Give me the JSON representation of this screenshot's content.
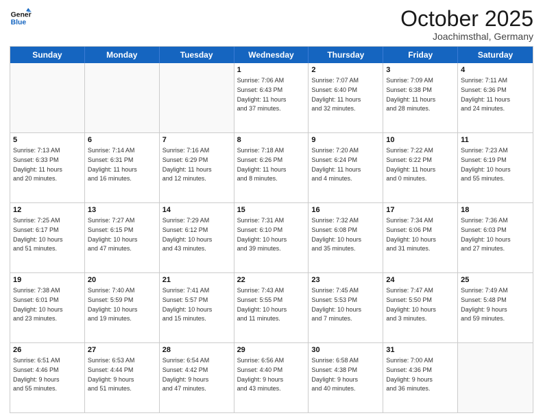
{
  "logo": {
    "line1": "General",
    "line2": "Blue"
  },
  "title": "October 2025",
  "location": "Joachimsthal, Germany",
  "weekdays": [
    "Sunday",
    "Monday",
    "Tuesday",
    "Wednesday",
    "Thursday",
    "Friday",
    "Saturday"
  ],
  "weeks": [
    [
      {
        "day": "",
        "text": ""
      },
      {
        "day": "",
        "text": ""
      },
      {
        "day": "",
        "text": ""
      },
      {
        "day": "1",
        "text": "Sunrise: 7:06 AM\nSunset: 6:43 PM\nDaylight: 11 hours\nand 37 minutes."
      },
      {
        "day": "2",
        "text": "Sunrise: 7:07 AM\nSunset: 6:40 PM\nDaylight: 11 hours\nand 32 minutes."
      },
      {
        "day": "3",
        "text": "Sunrise: 7:09 AM\nSunset: 6:38 PM\nDaylight: 11 hours\nand 28 minutes."
      },
      {
        "day": "4",
        "text": "Sunrise: 7:11 AM\nSunset: 6:36 PM\nDaylight: 11 hours\nand 24 minutes."
      }
    ],
    [
      {
        "day": "5",
        "text": "Sunrise: 7:13 AM\nSunset: 6:33 PM\nDaylight: 11 hours\nand 20 minutes."
      },
      {
        "day": "6",
        "text": "Sunrise: 7:14 AM\nSunset: 6:31 PM\nDaylight: 11 hours\nand 16 minutes."
      },
      {
        "day": "7",
        "text": "Sunrise: 7:16 AM\nSunset: 6:29 PM\nDaylight: 11 hours\nand 12 minutes."
      },
      {
        "day": "8",
        "text": "Sunrise: 7:18 AM\nSunset: 6:26 PM\nDaylight: 11 hours\nand 8 minutes."
      },
      {
        "day": "9",
        "text": "Sunrise: 7:20 AM\nSunset: 6:24 PM\nDaylight: 11 hours\nand 4 minutes."
      },
      {
        "day": "10",
        "text": "Sunrise: 7:22 AM\nSunset: 6:22 PM\nDaylight: 11 hours\nand 0 minutes."
      },
      {
        "day": "11",
        "text": "Sunrise: 7:23 AM\nSunset: 6:19 PM\nDaylight: 10 hours\nand 55 minutes."
      }
    ],
    [
      {
        "day": "12",
        "text": "Sunrise: 7:25 AM\nSunset: 6:17 PM\nDaylight: 10 hours\nand 51 minutes."
      },
      {
        "day": "13",
        "text": "Sunrise: 7:27 AM\nSunset: 6:15 PM\nDaylight: 10 hours\nand 47 minutes."
      },
      {
        "day": "14",
        "text": "Sunrise: 7:29 AM\nSunset: 6:12 PM\nDaylight: 10 hours\nand 43 minutes."
      },
      {
        "day": "15",
        "text": "Sunrise: 7:31 AM\nSunset: 6:10 PM\nDaylight: 10 hours\nand 39 minutes."
      },
      {
        "day": "16",
        "text": "Sunrise: 7:32 AM\nSunset: 6:08 PM\nDaylight: 10 hours\nand 35 minutes."
      },
      {
        "day": "17",
        "text": "Sunrise: 7:34 AM\nSunset: 6:06 PM\nDaylight: 10 hours\nand 31 minutes."
      },
      {
        "day": "18",
        "text": "Sunrise: 7:36 AM\nSunset: 6:03 PM\nDaylight: 10 hours\nand 27 minutes."
      }
    ],
    [
      {
        "day": "19",
        "text": "Sunrise: 7:38 AM\nSunset: 6:01 PM\nDaylight: 10 hours\nand 23 minutes."
      },
      {
        "day": "20",
        "text": "Sunrise: 7:40 AM\nSunset: 5:59 PM\nDaylight: 10 hours\nand 19 minutes."
      },
      {
        "day": "21",
        "text": "Sunrise: 7:41 AM\nSunset: 5:57 PM\nDaylight: 10 hours\nand 15 minutes."
      },
      {
        "day": "22",
        "text": "Sunrise: 7:43 AM\nSunset: 5:55 PM\nDaylight: 10 hours\nand 11 minutes."
      },
      {
        "day": "23",
        "text": "Sunrise: 7:45 AM\nSunset: 5:53 PM\nDaylight: 10 hours\nand 7 minutes."
      },
      {
        "day": "24",
        "text": "Sunrise: 7:47 AM\nSunset: 5:50 PM\nDaylight: 10 hours\nand 3 minutes."
      },
      {
        "day": "25",
        "text": "Sunrise: 7:49 AM\nSunset: 5:48 PM\nDaylight: 9 hours\nand 59 minutes."
      }
    ],
    [
      {
        "day": "26",
        "text": "Sunrise: 6:51 AM\nSunset: 4:46 PM\nDaylight: 9 hours\nand 55 minutes."
      },
      {
        "day": "27",
        "text": "Sunrise: 6:53 AM\nSunset: 4:44 PM\nDaylight: 9 hours\nand 51 minutes."
      },
      {
        "day": "28",
        "text": "Sunrise: 6:54 AM\nSunset: 4:42 PM\nDaylight: 9 hours\nand 47 minutes."
      },
      {
        "day": "29",
        "text": "Sunrise: 6:56 AM\nSunset: 4:40 PM\nDaylight: 9 hours\nand 43 minutes."
      },
      {
        "day": "30",
        "text": "Sunrise: 6:58 AM\nSunset: 4:38 PM\nDaylight: 9 hours\nand 40 minutes."
      },
      {
        "day": "31",
        "text": "Sunrise: 7:00 AM\nSunset: 4:36 PM\nDaylight: 9 hours\nand 36 minutes."
      },
      {
        "day": "",
        "text": ""
      }
    ]
  ]
}
